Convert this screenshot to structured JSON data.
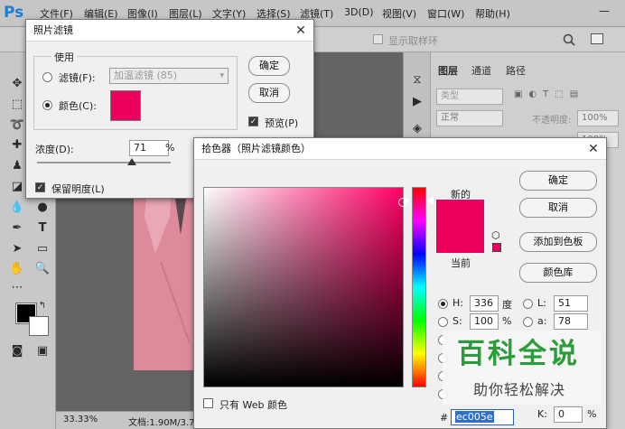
{
  "app": {
    "logo": "Ps",
    "menu": [
      "文件(F)",
      "编辑(E)",
      "图像(I)",
      "图层(L)",
      "文字(Y)",
      "选择(S)",
      "滤镜(T)",
      "3D(D)",
      "视图(V)",
      "窗口(W)",
      "帮助(H)"
    ],
    "window_min": "—",
    "options_sample_label": "显示取样环"
  },
  "status": {
    "zoom": "33.33%",
    "doc": "文档:1.90M/3.79"
  },
  "layers_panel": {
    "tabs": [
      "图层",
      "通道",
      "路径"
    ],
    "kind_label": "类型",
    "blend_mode": "正常",
    "opacity_label": "不透明度:",
    "opacity_value": "100%",
    "fill_value": "100%"
  },
  "photo_filter": {
    "title": "照片滤镜",
    "close": "✕",
    "group_label": "使用",
    "filter_label": "滤镜(F):",
    "filter_value": "加温滤镜 (85)",
    "color_label": "颜色(C):",
    "color_swatch": "#ec005e",
    "density_label": "浓度(D):",
    "density_value": "71",
    "density_unit": "%",
    "density_level": 0.71,
    "preserve_label": "保留明度(L)",
    "ok": "确定",
    "cancel": "取消",
    "preview_label": "预览(P)"
  },
  "color_picker": {
    "title": "拾色器（照片滤镜颜色）",
    "close": "✕",
    "ok": "确定",
    "cancel": "取消",
    "add_swatch": "添加到色板",
    "color_libraries": "颜色库",
    "new_label": "新的",
    "current_label": "当前",
    "new_color": "#ec005e",
    "current_color": "#ec005e",
    "hue_color": "#ff0066",
    "h_label": "H:",
    "h_value": "336",
    "h_unit": "度",
    "s_label": "S:",
    "s_value": "100",
    "s_unit": "%",
    "l_label": "L:",
    "l_value": "51",
    "a_label": "a:",
    "a_value": "78",
    "k_label": "K:",
    "k_value": "0",
    "k_unit": "%",
    "hash": "#",
    "hex_value": "ec005e",
    "web_only_label": "只有 Web 颜色"
  },
  "watermark": {
    "line1": "百科全说",
    "line2": "助你轻松解决",
    "color": "#2a9d3a"
  }
}
